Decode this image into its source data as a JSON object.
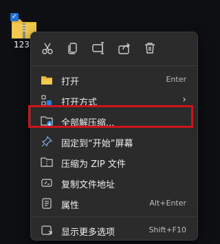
{
  "desktop": {
    "icon_label": "123",
    "checkbox_state": "checked"
  },
  "toolbar": {
    "cut_icon": "scissors-icon",
    "copy_icon": "copy-icon",
    "rename_icon": "rename-icon",
    "share_icon": "share-icon",
    "delete_icon": "trash-icon"
  },
  "menu": {
    "items": [
      {
        "label": "打开",
        "accelerator": "Enter",
        "icon": "folder-open-icon"
      },
      {
        "label": "打开方式",
        "submenu_indicator": "›",
        "icon": "open-with-icon"
      },
      {
        "label": "全部解压缩...",
        "icon": "extract-all-icon"
      },
      {
        "label": "固定到“开始”屏幕",
        "icon": "pin-icon"
      },
      {
        "label": "压缩为 ZIP 文件",
        "icon": "zip-icon"
      },
      {
        "label": "复制文件地址",
        "icon": "copy-path-icon"
      },
      {
        "label": "属性",
        "accelerator": "Alt+Enter",
        "icon": "properties-icon"
      },
      {
        "label": "显示更多选项",
        "accelerator": "Shift+F10",
        "icon": "more-options-icon"
      }
    ]
  },
  "colors": {
    "menu_bg": "#2b2b2b",
    "highlight_border": "#d3121a",
    "accent_blue": "#1f6fd6",
    "folder_yellow": "#e8b83a"
  }
}
